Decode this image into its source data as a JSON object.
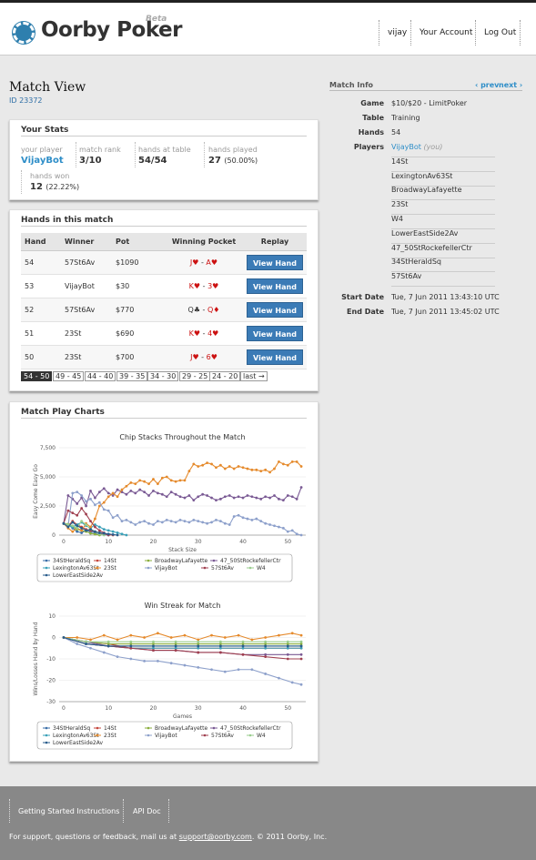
{
  "app": {
    "name": "Oorby Poker",
    "beta": "Beta"
  },
  "nav": {
    "user": "vijay",
    "account": "Your Account",
    "logout": "Log Out"
  },
  "page": {
    "title": "Match View",
    "id_text": "ID 23372"
  },
  "stats": {
    "heading": "Your Stats",
    "your_player_label": "your player",
    "your_player": "VijayBot",
    "rank_label": "match rank",
    "rank": "3/10",
    "hands_table_label": "hands at table",
    "hands_table": "54/54",
    "hands_played_label": "hands played",
    "hands_played": "27",
    "hands_played_pct": "(50.00%)",
    "hands_won_label": "hands won",
    "hands_won": "12",
    "hands_won_pct": "(22.22%)"
  },
  "hands": {
    "heading": "Hands in this match",
    "columns": [
      "Hand",
      "Winner",
      "Pot",
      "Winning Pocket",
      "Replay"
    ],
    "button_label": "View Hand",
    "rows": [
      {
        "hand": "54",
        "winner": "57St6Av",
        "pot": "$1090",
        "pocket": "J♥ - A♥"
      },
      {
        "hand": "53",
        "winner": "VijayBot",
        "pot": "$30",
        "pocket": "K♥ - 3♥"
      },
      {
        "hand": "52",
        "winner": "57St6Av",
        "pot": "$770",
        "pocket": "Q♣ - Q♦"
      },
      {
        "hand": "51",
        "winner": "23St",
        "pot": "$690",
        "pocket": "K♥ - 4♥"
      },
      {
        "hand": "50",
        "winner": "23St",
        "pot": "$700",
        "pocket": "J♥ - 6♥"
      }
    ],
    "pages": [
      "54 - 50",
      "49 - 45",
      "44 - 40",
      "39 - 35",
      "34 - 30",
      "29 - 25",
      "24 - 20",
      "last →"
    ]
  },
  "charts": {
    "heading": "Match Play Charts"
  },
  "chart_data": [
    {
      "type": "line",
      "title": "Chip Stacks Throughout the Match",
      "xlabel": "Stack Size",
      "ylabel": "Easy Come Easy Go",
      "xlim": [
        -1,
        54
      ],
      "ylim": [
        0,
        7500
      ],
      "yticks": [
        "0",
        "2,500",
        "5,000",
        "7,500"
      ],
      "xticks": [
        "0",
        "10",
        "20",
        "30",
        "40",
        "50"
      ],
      "series": [
        {
          "name": "34StHeraldSq",
          "color": "#3b6fa8",
          "x": [
            0,
            1,
            2,
            3,
            4,
            5,
            6,
            7,
            8,
            9,
            10
          ],
          "y": [
            1000,
            900,
            600,
            300,
            200,
            400,
            300,
            200,
            100,
            50,
            0
          ]
        },
        {
          "name": "14St",
          "color": "#c4463c",
          "x": [
            0,
            1,
            2,
            3,
            4,
            5,
            6,
            7,
            8,
            9,
            10,
            11
          ],
          "y": [
            1000,
            800,
            1200,
            900,
            700,
            500,
            400,
            300,
            200,
            100,
            50,
            0
          ]
        },
        {
          "name": "BroadwayLafayette",
          "color": "#8aae3c",
          "x": [
            0,
            1,
            2,
            3,
            4,
            5,
            6,
            7,
            8
          ],
          "y": [
            1000,
            950,
            700,
            500,
            400,
            300,
            150,
            80,
            0
          ]
        },
        {
          "name": "47_50StRockefellerCtr",
          "color": "#7a5a94",
          "x": [
            0,
            1,
            2,
            3,
            4,
            5,
            6,
            7,
            8,
            9,
            10,
            11,
            12,
            13,
            14,
            15,
            16,
            17,
            18,
            19,
            20,
            21,
            22,
            23,
            24,
            25,
            26,
            27,
            28,
            29,
            30,
            31,
            32,
            33,
            34,
            35,
            36,
            37,
            38,
            39,
            40,
            41,
            42,
            43,
            44,
            45,
            46,
            47,
            48,
            49,
            50,
            51,
            52,
            53
          ],
          "y": [
            1000,
            3400,
            3100,
            2700,
            3200,
            2500,
            3800,
            3200,
            3700,
            4000,
            3600,
            3400,
            3900,
            3700,
            3500,
            3800,
            3600,
            3900,
            3700,
            3400,
            3800,
            3600,
            3500,
            3300,
            3700,
            3500,
            3300,
            3200,
            3400,
            3000,
            3300,
            3500,
            3400,
            3200,
            3000,
            3100,
            3300,
            3400,
            3200,
            3300,
            3200,
            3400,
            3300,
            3200,
            3100,
            3300,
            3200,
            3400,
            3100,
            3000,
            3400,
            3300,
            3100,
            4100
          ]
        },
        {
          "name": "LexingtonAv63St",
          "color": "#3aa0b8",
          "x": [
            0,
            1,
            2,
            3,
            4,
            5,
            6,
            7,
            8,
            9,
            10,
            11,
            12,
            13,
            14
          ],
          "y": [
            1000,
            800,
            700,
            900,
            1100,
            800,
            600,
            900,
            700,
            500,
            400,
            300,
            200,
            100,
            0
          ]
        },
        {
          "name": "23St",
          "color": "#e58a2c",
          "x": [
            0,
            1,
            2,
            3,
            4,
            5,
            6,
            7,
            8,
            9,
            10,
            11,
            12,
            13,
            14,
            15,
            16,
            17,
            18,
            19,
            20,
            21,
            22,
            23,
            24,
            25,
            26,
            27,
            28,
            29,
            30,
            31,
            32,
            33,
            34,
            35,
            36,
            37,
            38,
            39,
            40,
            41,
            42,
            43,
            44,
            45,
            46,
            47,
            48,
            49,
            50,
            51,
            52,
            53
          ],
          "y": [
            1000,
            600,
            300,
            600,
            400,
            1000,
            700,
            1400,
            2500,
            2800,
            3300,
            3600,
            3300,
            3900,
            4200,
            4500,
            4400,
            4700,
            4600,
            4400,
            4800,
            4400,
            4900,
            5000,
            4700,
            4600,
            4700,
            4700,
            5500,
            6100,
            5900,
            6000,
            6200,
            6100,
            5800,
            6000,
            5700,
            5900,
            5700,
            5900,
            5800,
            5700,
            5600,
            5600,
            5500,
            5600,
            5400,
            5700,
            6300,
            6100,
            6000,
            6300,
            6300,
            5900
          ]
        },
        {
          "name": "VijayBot",
          "color": "#8da0cb",
          "x": [
            0,
            1,
            2,
            3,
            4,
            5,
            6,
            7,
            8,
            9,
            10,
            11,
            12,
            13,
            14,
            15,
            16,
            17,
            18,
            19,
            20,
            21,
            22,
            23,
            24,
            25,
            26,
            27,
            28,
            29,
            30,
            31,
            32,
            33,
            34,
            35,
            36,
            37,
            38,
            39,
            40,
            41,
            42,
            43,
            44,
            45,
            46,
            47,
            48,
            49,
            50,
            51,
            52,
            53
          ],
          "y": [
            1000,
            800,
            3600,
            3700,
            3400,
            2900,
            3100,
            2600,
            2800,
            2200,
            2100,
            1500,
            1700,
            1200,
            1300,
            1100,
            900,
            1100,
            1200,
            1000,
            900,
            1200,
            1100,
            1300,
            1200,
            1100,
            1300,
            1200,
            1100,
            1300,
            1200,
            1100,
            1000,
            1100,
            1300,
            1200,
            1000,
            900,
            1600,
            1700,
            1500,
            1400,
            1300,
            1400,
            1200,
            1000,
            900,
            800,
            700,
            600,
            300,
            400,
            100,
            0
          ]
        },
        {
          "name": "57St6Av",
          "color": "#a04050",
          "x": [
            0,
            1,
            2,
            3,
            4,
            5,
            6,
            7,
            8,
            9,
            10
          ],
          "y": [
            1000,
            2100,
            1900,
            1700,
            2300,
            1800,
            1200,
            700,
            400,
            200,
            0
          ]
        },
        {
          "name": "W4",
          "color": "#9acd8e",
          "x": [
            0,
            1,
            2,
            3,
            4,
            5,
            6,
            7,
            8,
            9
          ],
          "y": [
            1000,
            900,
            800,
            600,
            1200,
            900,
            500,
            300,
            100,
            0
          ]
        },
        {
          "name": "LowerEastSide2Av",
          "color": "#2a5d8c",
          "x": [
            0,
            1,
            2,
            3,
            4,
            5,
            6,
            7,
            8,
            9,
            10,
            11,
            12
          ],
          "y": [
            1000,
            700,
            1100,
            800,
            600,
            400,
            500,
            300,
            200,
            150,
            100,
            50,
            0
          ]
        }
      ]
    },
    {
      "type": "line",
      "title": "Win Streak for Match",
      "xlabel": "Games",
      "ylabel": "Wins/Losses Hand by Hand",
      "xlim": [
        -1,
        54
      ],
      "ylim": [
        -30,
        10
      ],
      "yticks": [
        "10",
        "0",
        "-10",
        "-20",
        "-30"
      ],
      "xticks": [
        "0",
        "10",
        "20",
        "30",
        "40",
        "50"
      ],
      "series": [
        {
          "name": "34StHeraldSq",
          "color": "#3b6fa8",
          "x": [
            0,
            5,
            10,
            15,
            20,
            25,
            30,
            35,
            40,
            45,
            50,
            53
          ],
          "y": [
            0,
            -3,
            -4,
            -4,
            -4,
            -4,
            -4,
            -4,
            -4,
            -4,
            -4,
            -4
          ]
        },
        {
          "name": "14St",
          "color": "#c4463c",
          "x": [
            0,
            5,
            10,
            15,
            20,
            25,
            30,
            35,
            40,
            45,
            50,
            53
          ],
          "y": [
            0,
            -2,
            -3,
            -5,
            -5,
            -5,
            -5,
            -5,
            -5,
            -5,
            -5,
            -5
          ]
        },
        {
          "name": "BroadwayLafayette",
          "color": "#8aae3c",
          "x": [
            0,
            5,
            10,
            15,
            20,
            25,
            30,
            35,
            40,
            45,
            50,
            53
          ],
          "y": [
            0,
            -2,
            -3,
            -3,
            -3,
            -3,
            -3,
            -3,
            -3,
            -3,
            -3,
            -3
          ]
        },
        {
          "name": "47_50StRockefellerCtr",
          "color": "#7a5a94",
          "x": [
            0,
            5,
            10,
            15,
            20,
            25,
            30,
            35,
            40,
            45,
            50,
            53
          ],
          "y": [
            0,
            -2,
            -4,
            -5,
            -6,
            -6,
            -7,
            -7,
            -8,
            -8,
            -8,
            -8
          ]
        },
        {
          "name": "LexingtonAv63St",
          "color": "#3aa0b8",
          "x": [
            0,
            5,
            10,
            15,
            20,
            25,
            30,
            35,
            40,
            45,
            50,
            53
          ],
          "y": [
            0,
            -3,
            -4,
            -5,
            -5,
            -5,
            -5,
            -5,
            -5,
            -5,
            -5,
            -5
          ]
        },
        {
          "name": "23St",
          "color": "#e58a2c",
          "x": [
            0,
            3,
            6,
            9,
            12,
            15,
            18,
            21,
            24,
            27,
            30,
            33,
            36,
            39,
            42,
            45,
            48,
            51,
            53
          ],
          "y": [
            0,
            0,
            -1,
            1,
            -1,
            1,
            0,
            2,
            0,
            1,
            -1,
            1,
            0,
            1,
            -1,
            0,
            1,
            2,
            1
          ]
        },
        {
          "name": "VijayBot",
          "color": "#8da0cb",
          "x": [
            0,
            3,
            6,
            9,
            12,
            15,
            18,
            21,
            24,
            27,
            30,
            33,
            36,
            39,
            42,
            45,
            48,
            51,
            53
          ],
          "y": [
            0,
            -3,
            -5,
            -7,
            -9,
            -10,
            -11,
            -11,
            -12,
            -13,
            -14,
            -15,
            -16,
            -15,
            -15,
            -17,
            -19,
            -21,
            -22
          ]
        },
        {
          "name": "57St6Av",
          "color": "#a04050",
          "x": [
            0,
            5,
            10,
            15,
            20,
            25,
            30,
            35,
            40,
            45,
            50,
            53
          ],
          "y": [
            0,
            -3,
            -4,
            -5,
            -6,
            -6,
            -7,
            -7,
            -8,
            -9,
            -10,
            -10
          ]
        },
        {
          "name": "W4",
          "color": "#9acd8e",
          "x": [
            0,
            5,
            10,
            15,
            20,
            25,
            30,
            35,
            40,
            45,
            50,
            53
          ],
          "y": [
            0,
            -2,
            -2,
            -2,
            -2,
            -2,
            -2,
            -2,
            -2,
            -2,
            -2,
            -2
          ]
        },
        {
          "name": "LowerEastSide2Av",
          "color": "#2a5d8c",
          "x": [
            0,
            5,
            10,
            15,
            20,
            25,
            30,
            35,
            40,
            45,
            50,
            53
          ],
          "y": [
            0,
            -3,
            -4,
            -4,
            -4,
            -4,
            -4,
            -4,
            -4,
            -4,
            -4,
            -4
          ]
        }
      ]
    }
  ],
  "info": {
    "heading": "Match Info",
    "prev": "‹ prev",
    "next": "next ›",
    "game_label": "Game",
    "game": "$10/$20 - LimitPoker",
    "table_label": "Table",
    "table": "Training",
    "hands_label": "Hands",
    "hands": "54",
    "players_label": "Players",
    "you": "(you)",
    "players": [
      "VijayBot",
      "14St",
      "LexingtonAv63St",
      "BroadwayLafayette",
      "23St",
      "W4",
      "LowerEastSide2Av",
      "47_50StRockefellerCtr",
      "34StHeraldSq",
      "57St6Av"
    ],
    "start_label": "Start Date",
    "start": "Tue, 7 Jun 2011 13:43:10 UTC",
    "end_label": "End Date",
    "end": "Tue, 7 Jun 2011 13:45:02 UTC"
  },
  "footer": {
    "link1": "Getting Started Instructions",
    "link2": "API Doc",
    "support_pre": "For support, questions or feedback, mail us at ",
    "support_email": "support@oorby.com",
    "support_post": ". © 2011 Oorby, Inc."
  }
}
